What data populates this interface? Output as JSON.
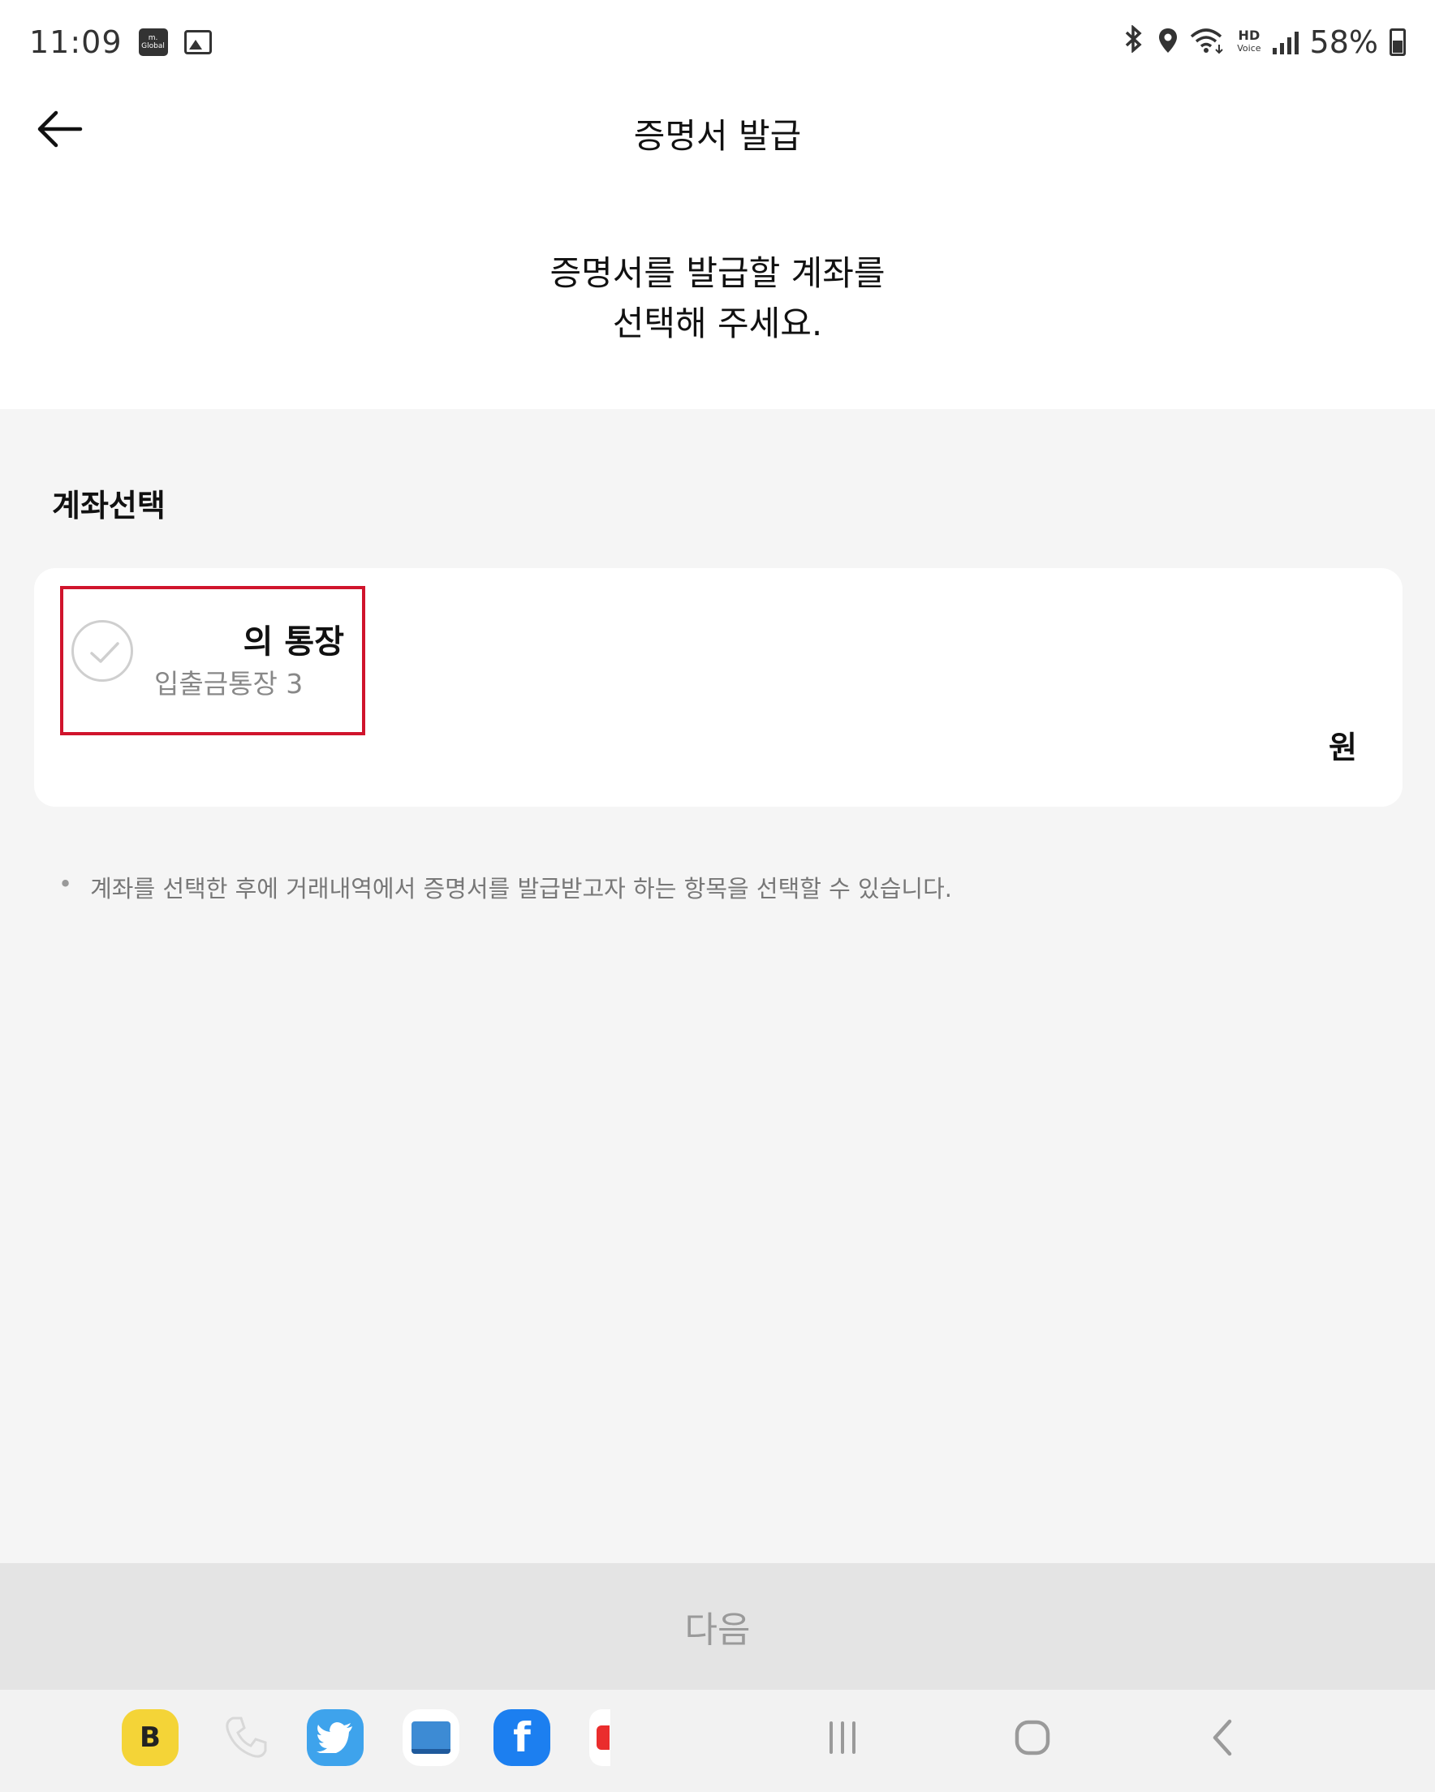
{
  "status_bar": {
    "time": "11:09",
    "notif_icons": [
      "m-global-app-icon",
      "gallery-icon"
    ],
    "mglobal_label": "m.\nGlobal",
    "hd_label": "HD",
    "voice_label": "Voice",
    "battery": "58%"
  },
  "header": {
    "title": "증명서 발급"
  },
  "intro": {
    "line1": "증명서를 발급할 계좌를",
    "line2": "선택해 주세요."
  },
  "section": {
    "title": "계좌선택"
  },
  "account": {
    "name": "의 통장",
    "type": "입출금통장 3",
    "balance_unit": "원",
    "selected": false
  },
  "notice": {
    "bullet": "•",
    "text": "계좌를 선택한 후에 거래내역에서 증명서를 발급받고자 하는 항목을 선택할 수 있습니다."
  },
  "footer": {
    "next_label": "다음"
  },
  "navbar": {
    "apps": [
      "bunjang-app",
      "phone-app",
      "twitter-app",
      "book-app",
      "facebook-app",
      "partial-app"
    ],
    "b_label": "B",
    "fb_label": "f"
  },
  "colors": {
    "highlight": "#d0142c",
    "next_button_bg": "#e4e4e4",
    "background": "#f5f5f5"
  }
}
